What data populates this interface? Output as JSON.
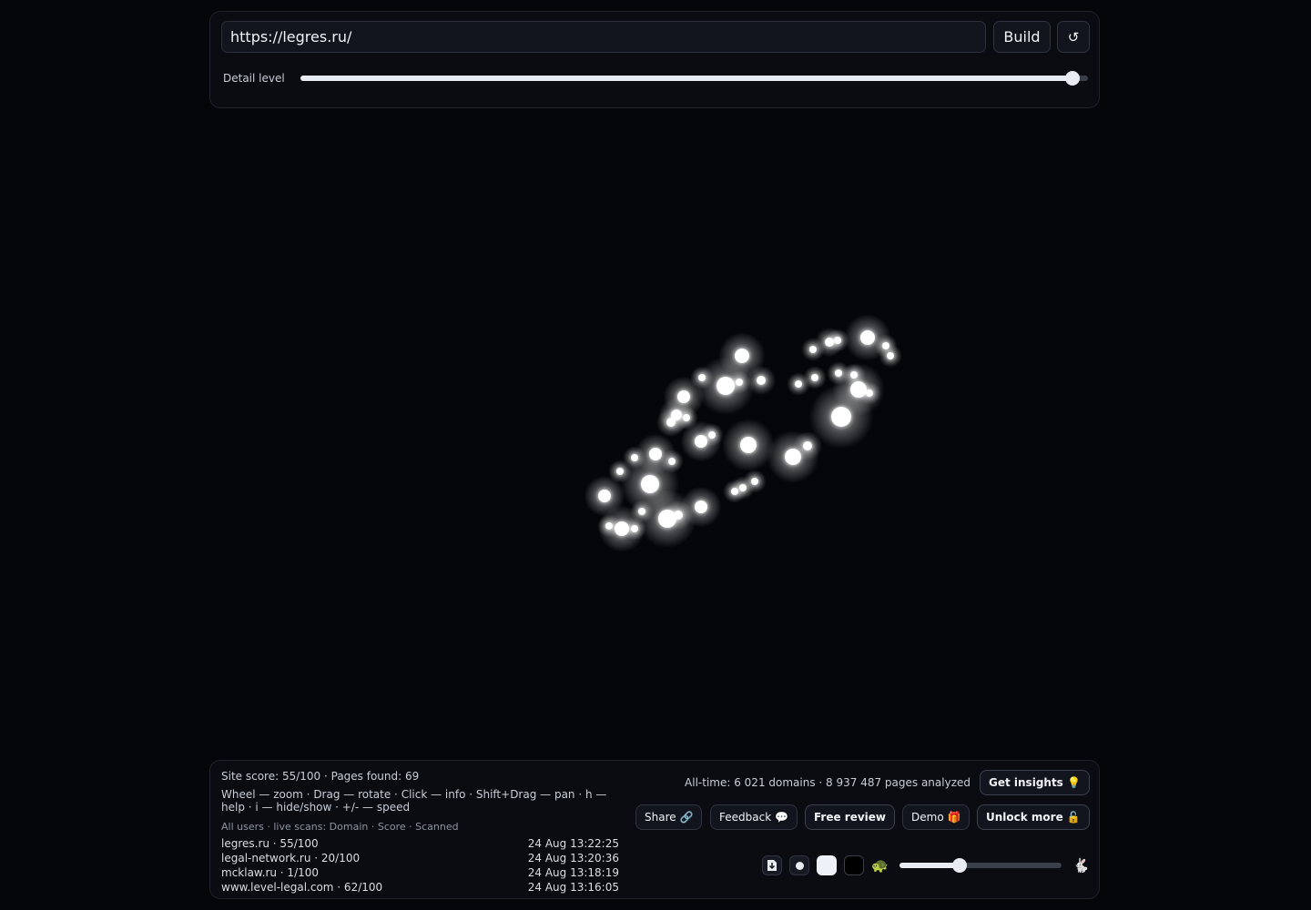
{
  "toolbar": {
    "url_value": "https://legres.ru/",
    "build_label": "Build",
    "reload_icon": "↺",
    "detail_label": "Detail level",
    "detail_value": 0.98
  },
  "graph": {
    "node_color": "#ffffff",
    "background": "#05060a"
  },
  "footer": {
    "stats": "Site score: 55/100 · Pages found: 69",
    "help": "Wheel — zoom · Drag — rotate · Click — info · Shift+Drag — pan · h — help · i — hide/show · +/- — speed",
    "scans_header": "All users · live scans: Domain · Score · Scanned",
    "scans": [
      {
        "domain": "legres.ru · 55/100",
        "time": "24 Aug 13:22:25"
      },
      {
        "domain": "legal-network.ru · 20/100",
        "time": "24 Aug 13:20:36"
      },
      {
        "domain": "mcklaw.ru · 1/100",
        "time": "24 Aug 13:18:19"
      },
      {
        "domain": "www.level-legal.com · 62/100",
        "time": "24 Aug 13:16:05"
      }
    ],
    "alltime": "All-time: 6 021 domains · 8 937 487 pages analyzed",
    "insights_label": "Get insights 💡",
    "share_label": "Share 🔗",
    "feedback_label": "Feedback 💬",
    "review_label": "Free review",
    "demo_label": "Demo 🎁",
    "unlock_label": "Unlock more 🔓",
    "speed_value": 0.37,
    "slow_icon": "🐢",
    "fast_icon": "🐇"
  }
}
